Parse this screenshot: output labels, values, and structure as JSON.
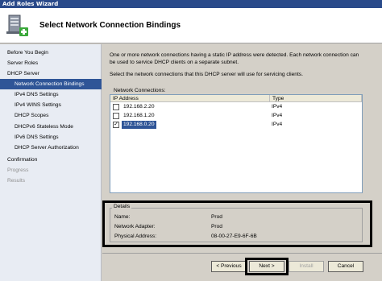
{
  "window": {
    "title": "Add Roles Wizard"
  },
  "header": {
    "title": "Select Network Connection Bindings",
    "icon": "network-server-add-icon"
  },
  "sidebar": {
    "items": [
      {
        "label": "Before You Begin",
        "state": "normal",
        "indent": 0
      },
      {
        "label": "Server Roles",
        "state": "normal",
        "indent": 0
      },
      {
        "label": "DHCP Server",
        "state": "normal",
        "indent": 0
      },
      {
        "label": "Network Connection Bindings",
        "state": "selected",
        "indent": 1
      },
      {
        "label": "IPv4 DNS Settings",
        "state": "normal",
        "indent": 1
      },
      {
        "label": "IPv4 WINS Settings",
        "state": "normal",
        "indent": 1
      },
      {
        "label": "DHCP Scopes",
        "state": "normal",
        "indent": 1
      },
      {
        "label": "DHCPv6 Stateless Mode",
        "state": "normal",
        "indent": 1
      },
      {
        "label": "IPv6 DNS Settings",
        "state": "normal",
        "indent": 1
      },
      {
        "label": "DHCP Server Authorization",
        "state": "normal",
        "indent": 1
      },
      {
        "label": "Confirmation",
        "state": "normal",
        "indent": 0
      },
      {
        "label": "Progress",
        "state": "disabled",
        "indent": 0
      },
      {
        "label": "Results",
        "state": "disabled",
        "indent": 0
      }
    ]
  },
  "main": {
    "description_line1": "One or more network connections having a static IP address were detected. Each network connection can",
    "description_line2": "be used to service DHCP clients on a separate subnet.",
    "instruction": "Select the network connections that this DHCP server will use for servicing clients.",
    "list_label": "Network Connections:",
    "columns": [
      "IP Address",
      "Type"
    ],
    "rows": [
      {
        "ip": "192.168.2.20",
        "type": "IPv4",
        "checked": false,
        "selected": false
      },
      {
        "ip": "192.168.1.20",
        "type": "IPv4",
        "checked": false,
        "selected": false
      },
      {
        "ip": "192.168.0.20",
        "type": "IPv4",
        "checked": true,
        "selected": true
      }
    ],
    "details": {
      "legend": "Details",
      "fields": [
        {
          "label": "Name:",
          "value": "Prod"
        },
        {
          "label": "Network Adapter:",
          "value": "Prod"
        },
        {
          "label": "Physical Address:",
          "value": "08-00-27-E9-6F-6B"
        }
      ]
    }
  },
  "footer": {
    "previous_label": "< Previous",
    "next_label": "Next >",
    "install_label": "Install",
    "cancel_label": "Cancel"
  },
  "colors": {
    "selection": "#2f5597",
    "title_bar": "#2a4a8a",
    "sidebar_bg": "#e8ecf3"
  }
}
